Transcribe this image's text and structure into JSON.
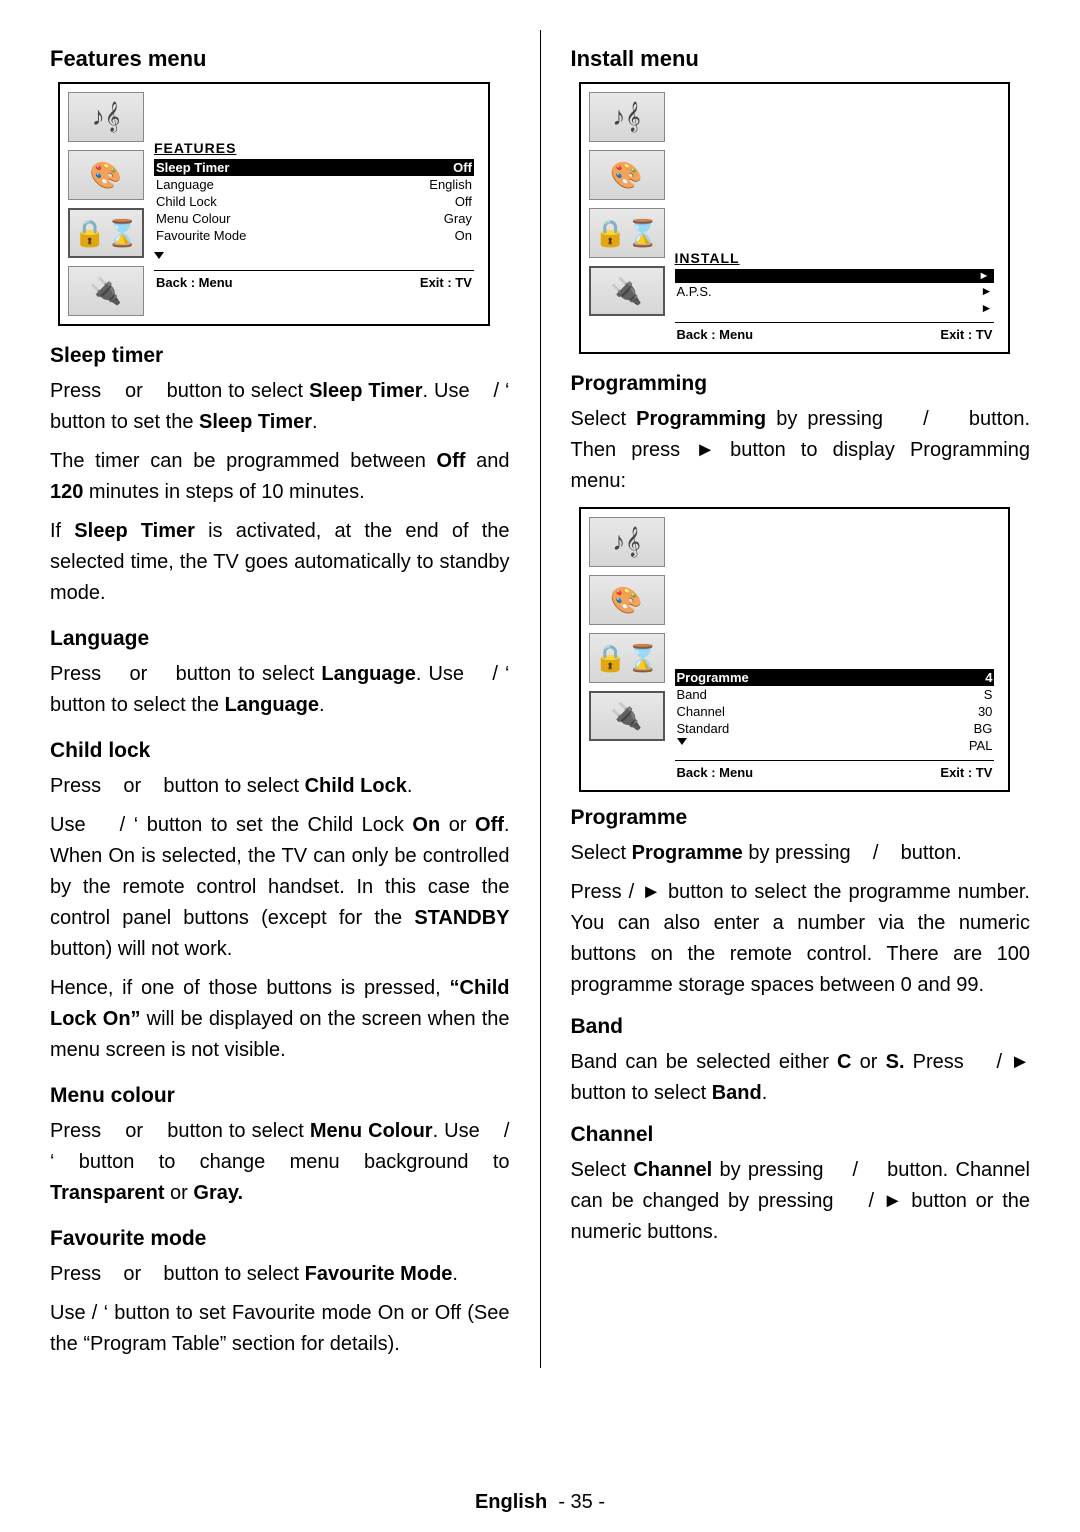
{
  "footer": {
    "lang": "English",
    "page": "- 35 -"
  },
  "left": {
    "features_menu_heading": "Features menu",
    "osd_features": {
      "title": "FEATURES",
      "rows": [
        {
          "label": "Sleep Timer",
          "value": "Off",
          "hl": true
        },
        {
          "label": "Language",
          "value": "English"
        },
        {
          "label": "Child Lock",
          "value": "Off"
        },
        {
          "label": "Menu Colour",
          "value": "Gray"
        },
        {
          "label": "Favourite Mode",
          "value": "On"
        }
      ],
      "back": "Back : Menu",
      "exit": "Exit : TV"
    },
    "sleep_timer_h": "Sleep timer",
    "sleep_timer_p1a": "Press ",
    "sleep_timer_p1b": " or ",
    "sleep_timer_p1c": " button to select ",
    "sleep_timer_p1d": "Sleep Timer",
    "sleep_timer_p1e": ". Use ",
    "sleep_timer_p1f": " / ‘ button to set the ",
    "sleep_timer_p1g": "Sleep Timer",
    "sleep_timer_p1h": ".",
    "sleep_timer_p2a": "The timer can be programmed between ",
    "sleep_timer_p2b": "Off",
    "sleep_timer_p2c": " and ",
    "sleep_timer_p2d": "120",
    "sleep_timer_p2e": " minutes in steps of 10 minutes.",
    "sleep_timer_p3a": "If ",
    "sleep_timer_p3b": "Sleep Timer",
    "sleep_timer_p3c": " is activated, at the end of the selected time, the TV goes automatically to standby mode.",
    "language_h": "Language",
    "language_p1a": "Press ",
    "language_p1b": " or ",
    "language_p1c": " button to select ",
    "language_p1d": "Language",
    "language_p1e": ". Use ",
    "language_p1f": " / ‘ button to select the ",
    "language_p1g": "Language",
    "language_p1h": ".",
    "childlock_h": "Child lock",
    "childlock_p1a": "Press ",
    "childlock_p1b": " or ",
    "childlock_p1c": " button to select ",
    "childlock_p1d": "Child Lock",
    "childlock_p1e": ".",
    "childlock_p2a": "Use ",
    "childlock_p2b": " / ‘ button  to set the Child Lock ",
    "childlock_p2c": "On",
    "childlock_p2d": " or ",
    "childlock_p2e": "Off",
    "childlock_p2f": ". When On is selected, the TV can only be controlled by the remote control handset. In this case the control panel buttons (except for the ",
    "childlock_p2g": "STANDBY",
    "childlock_p2h": " button) will not work.",
    "childlock_p3a": "Hence, if one of those buttons is pressed, ",
    "childlock_p3b": "“Child Lock On”",
    "childlock_p3c": " will be displayed on the screen when the menu screen is not visible.",
    "menucolour_h": "Menu colour",
    "menucolour_p1a": "Press ",
    "menucolour_p1b": " or ",
    "menucolour_p1c": " button to select ",
    "menucolour_p1d": "Menu Colour",
    "menucolour_p1e": ". Use ",
    "menucolour_p1f": " / ‘ button to change menu background to ",
    "menucolour_p1g": "Transparent",
    "menucolour_p1h": " or ",
    "menucolour_p1i": "Gray.",
    "favmode_h": "Favourite mode",
    "favmode_p1a": "Press ",
    "favmode_p1b": " or ",
    "favmode_p1c": " button to select ",
    "favmode_p1d": "Favourite Mode",
    "favmode_p1e": ".",
    "favmode_p2": "Use   / ‘ button to set Favourite mode On or Off (See the “Program Table” section for details)."
  },
  "right": {
    "install_menu_heading": "Install menu",
    "osd_install": {
      "title": "INSTALL",
      "rows": [
        {
          "label": "",
          "value": "",
          "hl": true,
          "arrowbox": true
        },
        {
          "label": "A.P.S.",
          "value": "",
          "arrow": true
        },
        {
          "label": "",
          "value": "",
          "arrow": true
        }
      ],
      "back": "Back : Menu",
      "exit": "Exit : TV"
    },
    "programming_h": "Programming",
    "programming_p1a": "Select ",
    "programming_p1b": "Programming",
    "programming_p1c": " by pressing ",
    "programming_p1d": " / ",
    "programming_p1e": " button. Then press ► button to display Programming menu:",
    "osd_programming": {
      "rows": [
        {
          "label": "Programme",
          "value": "4",
          "hl": true
        },
        {
          "label": "Band",
          "value": "S"
        },
        {
          "label": "Channel",
          "value": "30"
        },
        {
          "label": "Standard",
          "value": "BG"
        },
        {
          "label": "",
          "value": "PAL",
          "tri": true
        }
      ],
      "back": "Back : Menu",
      "exit": "Exit : TV"
    },
    "programme_h": "Programme",
    "programme_p1a": "Select ",
    "programme_p1b": "Programme",
    "programme_p1c": "  by pressing ",
    "programme_p1d": " / ",
    "programme_p1e": " button.",
    "programme_p2": "Press   / ► button to select the programme number. You can also enter a number via the numeric buttons on the remote control. There are 100 programme storage spaces between 0 and 99.",
    "band_h": "Band",
    "band_p1a": "Band can be selected either ",
    "band_p1b": "C",
    "band_p1c": " or ",
    "band_p1d": "S.",
    "band_p1e": " Press ",
    "band_p2a": " / ► button to select ",
    "band_p2b": "Band",
    "band_p2c": ".",
    "channel_h": "Channel",
    "channel_p1a": "Select ",
    "channel_p1b": "Channel",
    "channel_p1c": " by pressing ",
    "channel_p1d": " / ",
    "channel_p1e": " button. Channel can be changed by pressing ",
    "channel_p1f": " / ► button or the numeric buttons."
  }
}
